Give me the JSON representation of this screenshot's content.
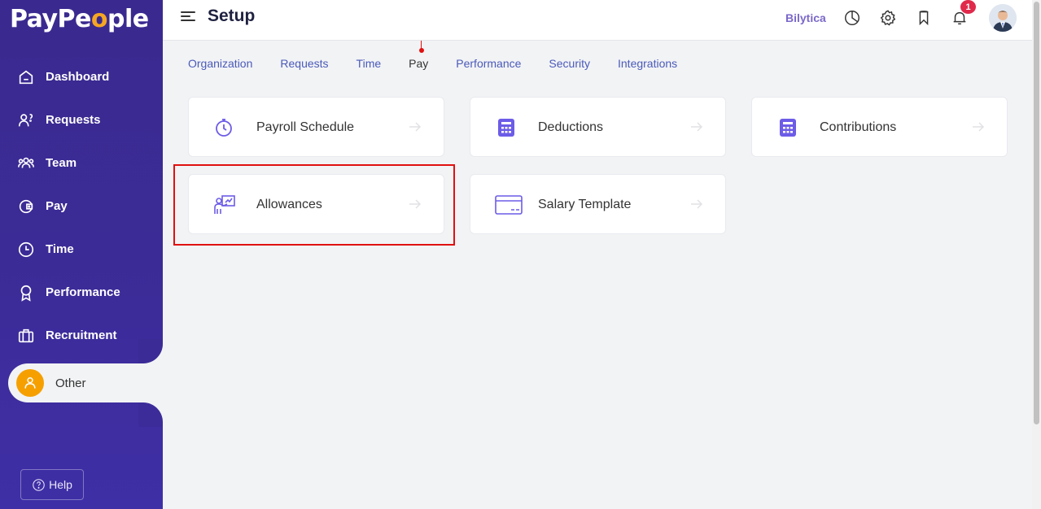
{
  "brand": {
    "logo_text": "PayPe",
    "logo_o": "o",
    "logo_rest": "ple"
  },
  "sidebar": {
    "items": [
      {
        "label": "Dashboard",
        "icon": "home-icon"
      },
      {
        "label": "Requests",
        "icon": "requests-icon"
      },
      {
        "label": "Team",
        "icon": "team-icon"
      },
      {
        "label": "Pay",
        "icon": "wallet-icon"
      },
      {
        "label": "Time",
        "icon": "clock-icon"
      },
      {
        "label": "Performance",
        "icon": "award-icon"
      },
      {
        "label": "Recruitment",
        "icon": "briefcase-icon"
      }
    ],
    "active": {
      "label": "Other",
      "icon": "user-icon"
    },
    "help_label": "Help"
  },
  "header": {
    "title": "Setup",
    "company": "Bilytica",
    "notification_count": "1"
  },
  "tabs": [
    {
      "label": "Organization"
    },
    {
      "label": "Requests"
    },
    {
      "label": "Time"
    },
    {
      "label": "Pay"
    },
    {
      "label": "Performance"
    },
    {
      "label": "Security"
    },
    {
      "label": "Integrations"
    }
  ],
  "active_tab": "Pay",
  "cards": [
    {
      "label": "Payroll Schedule",
      "icon": "stopwatch-icon"
    },
    {
      "label": "Deductions",
      "icon": "calculator-icon"
    },
    {
      "label": "Contributions",
      "icon": "calculator-icon"
    },
    {
      "label": "Allowances",
      "icon": "presenter-icon"
    },
    {
      "label": "Salary Template",
      "icon": "card-icon"
    }
  ],
  "colors": {
    "sidebar": "#3b2b96",
    "accent": "#6c5ce7",
    "tab": "#4a5ab9",
    "highlight": "#e01010",
    "badge": "#e02a4b"
  }
}
